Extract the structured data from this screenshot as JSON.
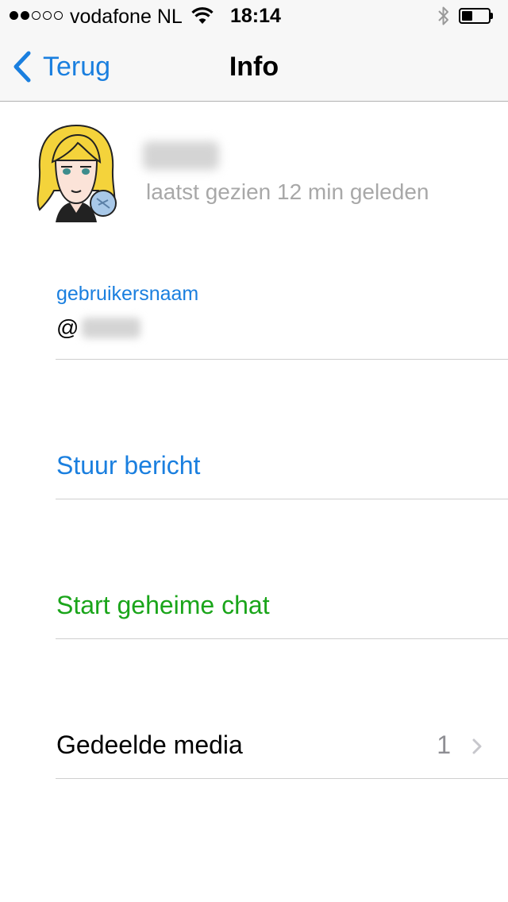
{
  "status_bar": {
    "signal_full": 2,
    "signal_empty": 3,
    "carrier": "vodafone NL",
    "time": "18:14",
    "icons": [
      "wifi-icon",
      "bluetooth-icon",
      "battery-icon"
    ],
    "battery_level": 0.4
  },
  "nav": {
    "back_label": "Terug",
    "title": "Info"
  },
  "profile": {
    "last_seen": "laatst gezien 12 min geleden"
  },
  "username": {
    "label": "gebruikersnaam",
    "prefix": "@"
  },
  "actions": {
    "send_message": "Stuur bericht",
    "secret_chat": "Start geheime chat"
  },
  "media": {
    "label": "Gedeelde media",
    "count": "1"
  },
  "colors": {
    "accent": "#1a7fdf",
    "secret": "#1aa51a",
    "secondary_text": "#a8a8a8"
  }
}
